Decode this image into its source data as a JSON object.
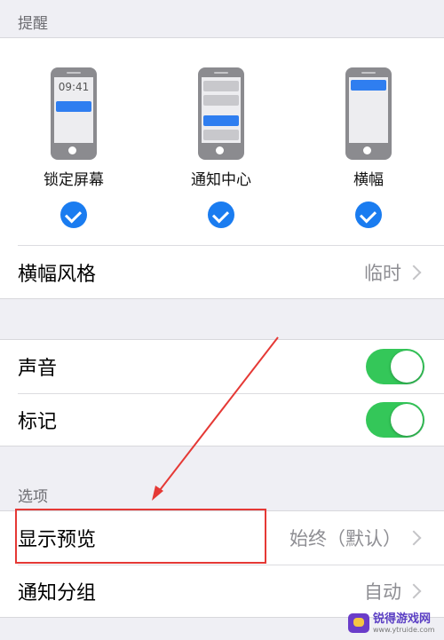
{
  "sections": {
    "alerts_header": "提醒",
    "options_header": "选项"
  },
  "alert_styles": [
    {
      "label": "锁定屏幕",
      "time": "09:41",
      "checked": true
    },
    {
      "label": "通知中心",
      "checked": true
    },
    {
      "label": "横幅",
      "checked": true
    }
  ],
  "banner_style": {
    "label": "横幅风格",
    "value": "临时"
  },
  "sounds": {
    "label": "声音",
    "on": true
  },
  "badges": {
    "label": "标记",
    "on": true
  },
  "show_previews": {
    "label": "显示预览",
    "value": "始终（默认）"
  },
  "grouping": {
    "label": "通知分组",
    "value": "自动"
  },
  "watermark": {
    "title": "锐得游戏网",
    "url": "www.ytruide.com"
  },
  "colors": {
    "accent": "#1a7cf0",
    "toggle_on": "#34c759",
    "annotation": "#e53935"
  }
}
